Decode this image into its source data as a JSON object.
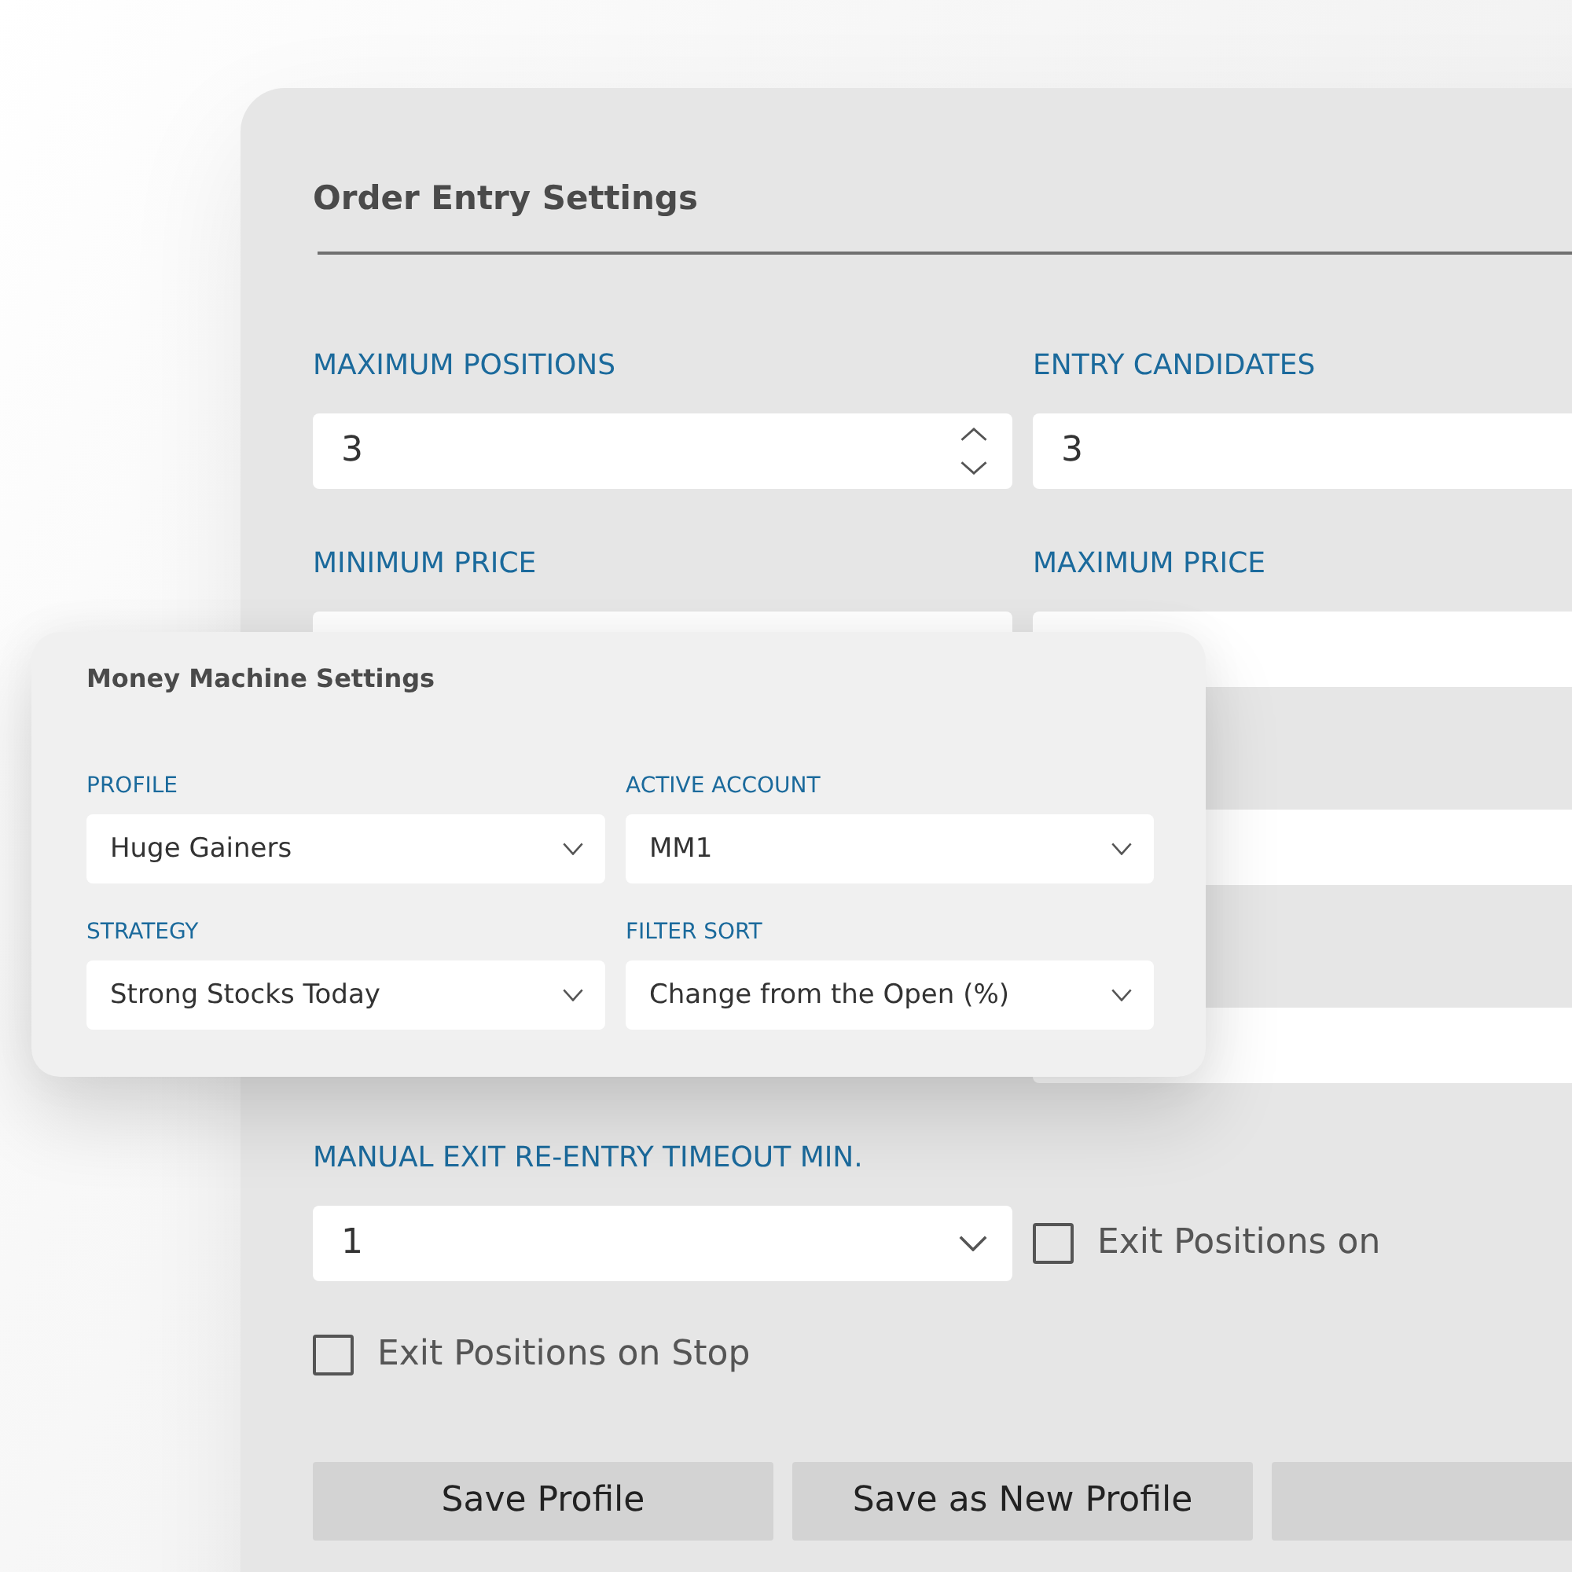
{
  "order_entry_settings": {
    "title": "Order Entry Settings",
    "rows": [
      {
        "left": {
          "kind": "spinner",
          "label": "MAXIMUM POSITIONS",
          "value": "3"
        },
        "right": {
          "kind": "input",
          "label": "ENTRY CANDIDATES",
          "value": "3"
        }
      },
      {
        "left": {
          "kind": "input",
          "label": "MINIMUM PRICE"
        },
        "right": {
          "kind": "input",
          "label": "MAXIMUM PRICE"
        }
      },
      {
        "right": {
          "kind": "input"
        }
      },
      {
        "right": {
          "kind": "input"
        }
      },
      {
        "left": {
          "kind": "select",
          "label": "MANUAL EXIT RE-ENTRY TIMEOUT MIN.",
          "value": "1"
        },
        "right": {
          "kind": "checkbox",
          "label": "Exit Positions on",
          "checked": false
        }
      }
    ],
    "options": [
      {
        "label": "Exit Positions on Stop",
        "checked": false
      }
    ],
    "buttons": [
      {
        "label": "Save Profile"
      },
      {
        "label": "Save as New Profile"
      }
    ]
  },
  "money_machine_settings": {
    "title": "Money Machine Settings",
    "fields": [
      {
        "label": "PROFILE",
        "value": "Huge Gainers"
      },
      {
        "label": "ACTIVE ACCOUNT",
        "value": "MM1"
      },
      {
        "label": "STRATEGY",
        "value": "Strong Stocks Today"
      },
      {
        "label": "FILTER SORT",
        "value": "Change from the Open (%)"
      }
    ]
  }
}
